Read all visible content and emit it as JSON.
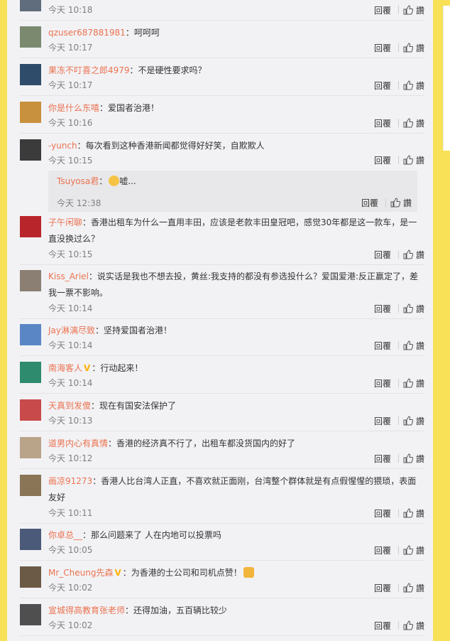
{
  "labels": {
    "reply": "回覆",
    "like": "讚"
  },
  "top": {
    "time": "今天 10:18"
  },
  "comments": [
    {
      "user": "qzuser687881981",
      "verified": false,
      "text": "：呵呵呵",
      "time": "今天 10:17",
      "avatar_color": "#7b8a6f"
    },
    {
      "user": "果冻不叮喜之郎4979",
      "verified": false,
      "text": "：不是硬性要求吗？",
      "time": "今天 10:17",
      "avatar_color": "#2f4d6b"
    },
    {
      "user": "你是什么东嘻",
      "verified": false,
      "text": "：爱国者治港！",
      "time": "今天 10:16",
      "avatar_color": "#c8913e"
    },
    {
      "user": "-yunch",
      "verified": false,
      "text": "：每次看到这种香港新闻都觉得好好笑，自欺欺人",
      "time": "今天 10:15",
      "avatar_color": "#3b3b3b"
    },
    {
      "user": "子午闲聊",
      "verified": false,
      "text": "：香港出租车为什么一直用丰田，应该是老款丰田皇冠吧，感觉30年都是这一款车，是一直没换过么？",
      "time": "今天 10:15",
      "avatar_color": "#b8252a"
    },
    {
      "user": "Kiss_Ariel",
      "verified": false,
      "text": "：说实话是我也不想去投，黄丝:我支持的都没有参选投什么？爱国爱港:反正赢定了，差我一票不影响。",
      "time": "今天 10:14",
      "avatar_color": "#8a7f72"
    },
    {
      "user": "Jay淋漓尽致",
      "verified": false,
      "text": "：坚持爱国者治港！",
      "time": "今天 10:14",
      "avatar_color": "#5a86c5"
    },
    {
      "user": "南海客人",
      "verified": true,
      "text": "：行动起来！",
      "time": "今天 10:14",
      "avatar_color": "#2e8b6e"
    },
    {
      "user": "天真到发傻",
      "verified": false,
      "text": "：现在有国安法保护了",
      "time": "今天 10:13",
      "avatar_color": "#c94a4a"
    },
    {
      "user": "道男内心有真情",
      "verified": false,
      "text": "：香港的经济真不行了，出租车都没货国内的好了",
      "time": "今天 10:12",
      "avatar_color": "#b9a48a"
    },
    {
      "user": "画凉91273",
      "verified": false,
      "text": "：香港人比台湾人正直，不喜欢就正面刚，台湾整个群体就是有点假惺惺的猥琐，表面友好",
      "time": "今天 10:11",
      "avatar_color": "#8a7556"
    },
    {
      "user": "你卓总__",
      "verified": false,
      "text": "：那么问题来了 人在内地可以投票吗",
      "time": "今天 10:05",
      "avatar_color": "#4a5a78"
    },
    {
      "user": "Mr_Cheung先森",
      "verified": true,
      "text": "：为香港的士公司和司机点赞！",
      "time": "今天 10:02",
      "avatar_color": "#6b5a45"
    },
    {
      "user": "宣城得高教育张老师",
      "verified": false,
      "text": "：还得加油，五百辆比较少",
      "time": "今天 10:02",
      "avatar_color": "#4f4f4f"
    }
  ],
  "subreply": {
    "user": "Tsuyosa君",
    "text": "嘘...",
    "time": "今天 12:38"
  }
}
